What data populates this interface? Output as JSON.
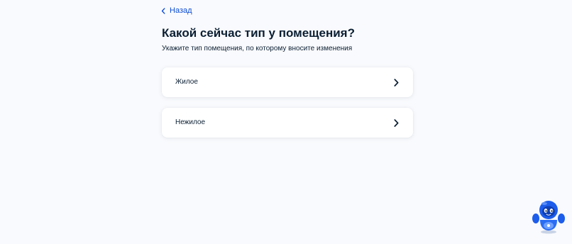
{
  "nav": {
    "back_label": "Назад"
  },
  "page": {
    "title": "Какой сейчас тип у помещения?",
    "subtitle": "Укажите тип помещения, по которому вносите изменения"
  },
  "options": [
    {
      "label": "Жилое",
      "icon": "chevron-right-icon"
    },
    {
      "label": "Нежилое",
      "icon": "chevron-right-icon"
    }
  ],
  "assistant": {
    "icon": "robot-assistant-icon"
  },
  "colors": {
    "background": "#f9fafd",
    "link": "#0d4cd3",
    "text": "#0b1f33",
    "chevron": "#0b1f33",
    "card": "#ffffff",
    "assistant_primary": "#1d5deb"
  }
}
